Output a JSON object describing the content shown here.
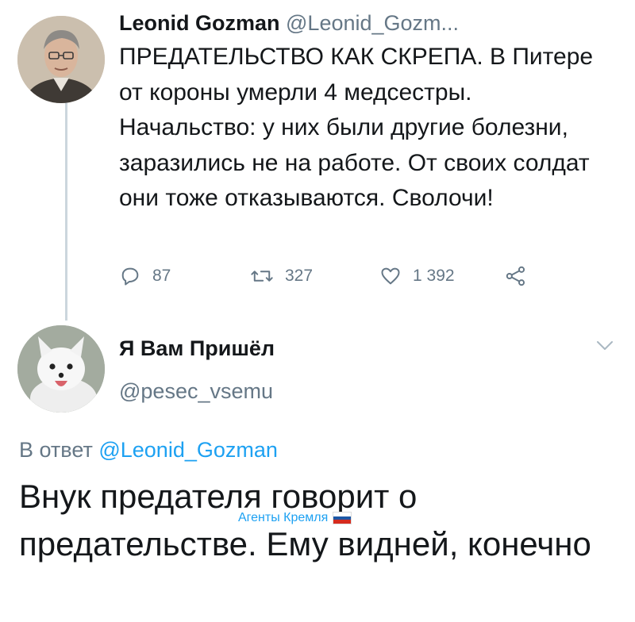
{
  "tweet1": {
    "name": "Leonid Gozman",
    "handle": "@Leonid_Gozm...",
    "text": "ПРЕДАТЕЛЬСТВО КАК СКРЕПА. В Питере от короны умерли 4 медсестры. Начальство: у них были другие болезни, заразились не на работе. От своих солдат они тоже отказываются. Сволочи!",
    "replies": "87",
    "retweets": "327",
    "likes": "1 392"
  },
  "tweet2": {
    "name": "Я Вам Пришёл",
    "handle": "@pesec_vsemu",
    "reply_prefix": "В ответ",
    "reply_mention": "@Leonid_Gozman",
    "text": "Внук предателя говорит о предательстве. Ему видней, конечно"
  },
  "watermark": {
    "text": "Агенты Кремля",
    "flag_colors": [
      "#ffffff",
      "#1c57a5",
      "#d52b1e"
    ]
  },
  "colors": {
    "text": "#14171a",
    "muted": "#657786",
    "link": "#1da1f2",
    "thread_line": "#ccd6dd"
  },
  "icons": [
    "reply-icon",
    "retweet-icon",
    "like-icon",
    "share-icon",
    "chevron-down-icon"
  ]
}
